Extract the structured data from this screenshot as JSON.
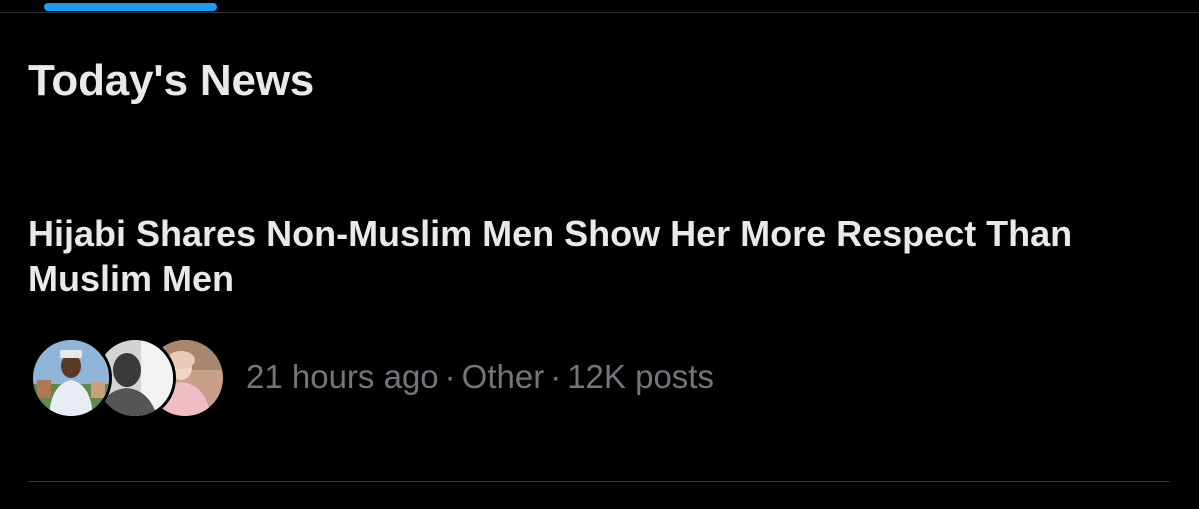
{
  "colors": {
    "background": "#000000",
    "primary_text": "#e7e9ea",
    "secondary_text": "#71767b",
    "accent": "#1d9bf0",
    "divider": "#2f3336"
  },
  "section": {
    "title": "Today's News"
  },
  "news_item": {
    "headline": "Hijabi Shares Non-Muslim Men Show Her More Respect Than Muslim Men",
    "time": "21 hours ago",
    "separator": "·",
    "category": "Other",
    "post_count": "12K posts"
  }
}
